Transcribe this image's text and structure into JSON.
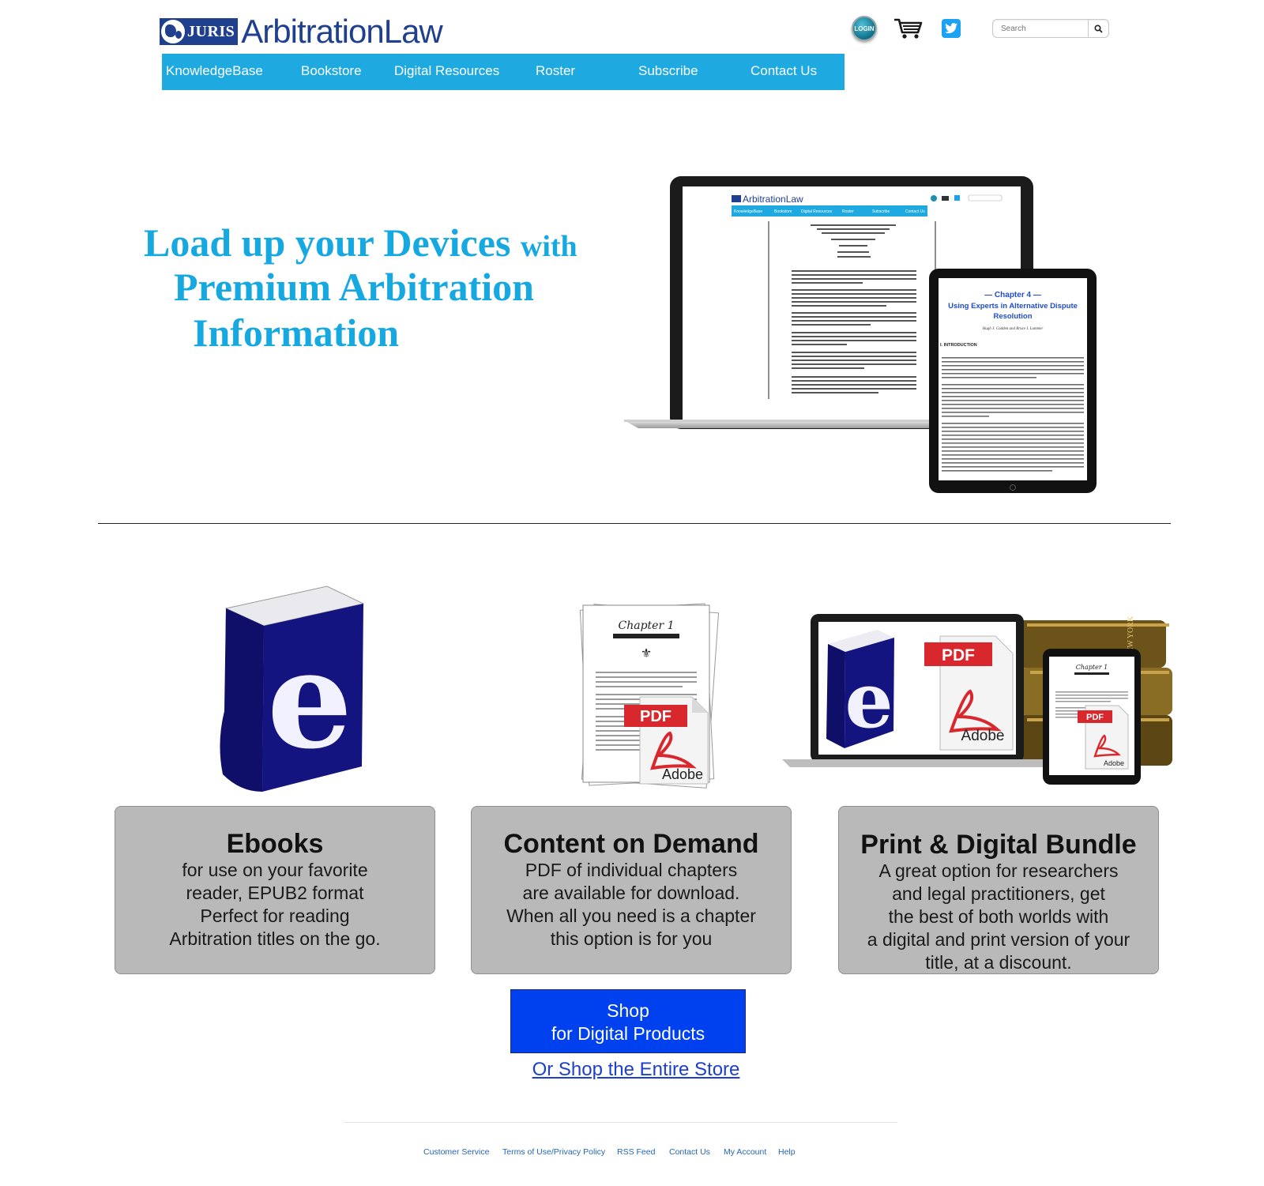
{
  "header": {
    "logo_badge": "JURIS",
    "logo_text": "ArbitrationLaw",
    "login_label": "LOGIN",
    "search": {
      "placeholder": "Search"
    }
  },
  "nav": {
    "items": [
      "KnowledgeBase",
      "Bookstore",
      "Digital Resources",
      "Roster",
      "Subscribe",
      "Contact Us"
    ],
    "color": "#1ea9e1"
  },
  "hero": {
    "line1_main": "Load up your Devices",
    "line1_small": "with",
    "line2": "Premium Arbitration",
    "line3": "Information",
    "color": "#16a9e1",
    "laptop_screen": {
      "logo": "ArbitrationLaw",
      "nav": [
        "KnowledgeBase",
        "Bookstore",
        "Digital Resources",
        "Roster",
        "Subscribe",
        "Contact Us"
      ]
    },
    "tablet_screen": {
      "chapter": "— Chapter 4 —",
      "title_l1": "Using Experts in Alternative Dispute",
      "title_l2": "Resolution",
      "authors": "Hugh J. Cadden and Bruce I. Lammer",
      "section": "I.      INTRODUCTION"
    }
  },
  "products": [
    {
      "title": "Ebooks",
      "lines": [
        "for use on your favorite",
        "reader, EPUB2 format",
        "Perfect for reading",
        "Arbitration titles on the go."
      ]
    },
    {
      "title": "Content on Demand",
      "lines": [
        "PDF of individual chapters",
        "are available for download.",
        "When all you need is a chapter",
        "this option is for you"
      ]
    },
    {
      "title": "Print & Digital Bundle",
      "lines": [
        "A great option for researchers",
        "and legal practitioners, get",
        "the best of both worlds with",
        "a digital and print version of your",
        "title, at a discount."
      ]
    }
  ],
  "image_labels": {
    "ebook_letter": "e",
    "pdf": "PDF",
    "adobe": "Adobe",
    "chapter": "Chapter 1",
    "spine_text": "NEW YORK"
  },
  "cta": {
    "shop_line1": "Shop",
    "shop_line2": "for Digital Products",
    "store_link": "Or Shop the Entire Store",
    "button_color": "#0041ef"
  },
  "footer": {
    "links": [
      "Customer Service",
      "Terms of Use/Privacy Policy",
      "RSS Feed",
      "Contact Us",
      "My Account",
      "Help"
    ]
  }
}
